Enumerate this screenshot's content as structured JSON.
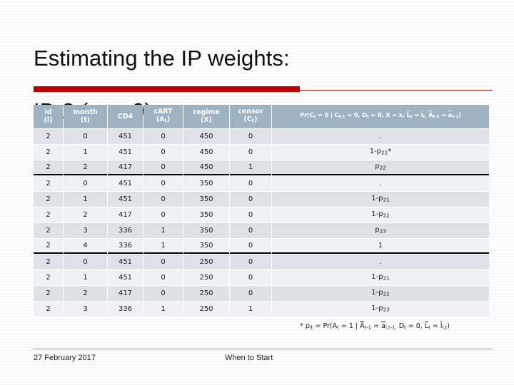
{
  "slide": {
    "title_line1": "Estimating the IP weights:",
    "title_line2_pre": "ID 2 (",
    "title_line2_italic": "m",
    "title_line2_post": " = 0)",
    "accent_color": "#c00000",
    "header_bg_color": "#9fb2c2",
    "row_color_odd": "#dee2e8",
    "row_color_even": "#eff1f4"
  },
  "table": {
    "headers": [
      {
        "line1": "id",
        "line2": "(i)"
      },
      {
        "line1": "month",
        "line2": "(t)"
      },
      {
        "line1": "CD4",
        "line2": ""
      },
      {
        "line1": "cART",
        "line2": "(A",
        "sub2": "t",
        "close2": ")"
      },
      {
        "line1": "regime",
        "line2": "(X)"
      },
      {
        "line1": "censor",
        "line2": "(C",
        "sub2": "t",
        "close2": ")"
      }
    ],
    "formula_header": "Pr(C_t = 0 | C_t-1 = 0, D_t = 0, X = x, L̄_t = l̄_t, Ā_t-1 = ā_t-1)",
    "rows": [
      {
        "id": "2",
        "month": "0",
        "cd4": "451",
        "cart": "0",
        "regime": "450",
        "censor": "0",
        "prob": ".",
        "group": 1,
        "group_end": false
      },
      {
        "id": "2",
        "month": "1",
        "cd4": "451",
        "cart": "0",
        "regime": "450",
        "censor": "0",
        "prob": "1-p21*",
        "group": 1,
        "group_end": false
      },
      {
        "id": "2",
        "month": "2",
        "cd4": "417",
        "cart": "0",
        "regime": "450",
        "censor": "1",
        "prob": "p22",
        "group": 1,
        "group_end": true
      },
      {
        "id": "2",
        "month": "0",
        "cd4": "451",
        "cart": "0",
        "regime": "350",
        "censor": "0",
        "prob": ".",
        "group": 2,
        "group_end": false
      },
      {
        "id": "2",
        "month": "1",
        "cd4": "451",
        "cart": "0",
        "regime": "350",
        "censor": "0",
        "prob": "1-p21",
        "group": 2,
        "group_end": false
      },
      {
        "id": "2",
        "month": "2",
        "cd4": "417",
        "cart": "0",
        "regime": "350",
        "censor": "0",
        "prob": "1-p22",
        "group": 2,
        "group_end": false
      },
      {
        "id": "2",
        "month": "3",
        "cd4": "336",
        "cart": "1",
        "regime": "350",
        "censor": "0",
        "prob": "p23",
        "group": 2,
        "group_end": false
      },
      {
        "id": "2",
        "month": "4",
        "cd4": "336",
        "cart": "1",
        "regime": "350",
        "censor": "0",
        "prob": "1",
        "group": 2,
        "group_end": true
      },
      {
        "id": "2",
        "month": "0",
        "cd4": "451",
        "cart": "0",
        "regime": "250",
        "censor": "0",
        "prob": ".",
        "group": 3,
        "group_end": false
      },
      {
        "id": "2",
        "month": "1",
        "cd4": "451",
        "cart": "0",
        "regime": "250",
        "censor": "0",
        "prob": "1-p21",
        "group": 3,
        "group_end": false
      },
      {
        "id": "2",
        "month": "2",
        "cd4": "417",
        "cart": "0",
        "regime": "250",
        "censor": "0",
        "prob": "1-p22",
        "group": 3,
        "group_end": false
      },
      {
        "id": "2",
        "month": "3",
        "cd4": "336",
        "cart": "1",
        "regime": "250",
        "censor": "1",
        "prob": "1-p23",
        "group": 3,
        "group_end": false
      }
    ]
  },
  "footnote": "* p_it = Pr(A_t = 1 | Ā_t-1 = ā_i,t-1, D_t = 0, L̄_t = l̄_i,t)",
  "footer": {
    "date": "27 February 2017",
    "section": "When to Start"
  }
}
